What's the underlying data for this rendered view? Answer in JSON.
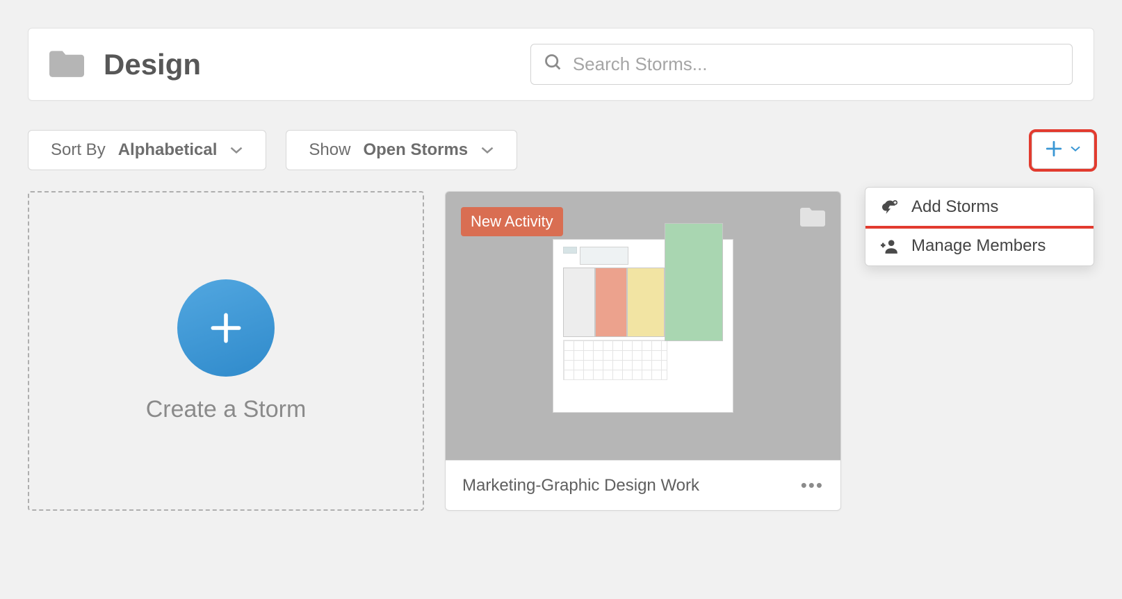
{
  "header": {
    "title": "Design",
    "search_placeholder": "Search Storms..."
  },
  "controls": {
    "sort": {
      "prefix": "Sort By ",
      "value": "Alphabetical"
    },
    "show": {
      "prefix": "Show ",
      "value": "Open Storms"
    }
  },
  "create_card": {
    "label": "Create a Storm"
  },
  "storm_card": {
    "badge": "New Activity",
    "title": "Marketing-Graphic Design Work"
  },
  "dropdown": {
    "items": [
      {
        "label": "Add Storms"
      },
      {
        "label": "Manage Members"
      }
    ]
  }
}
